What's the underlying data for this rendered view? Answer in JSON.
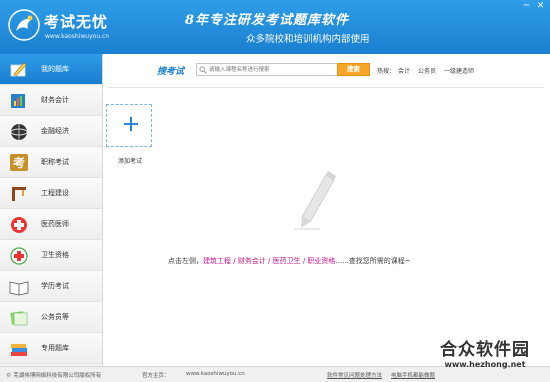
{
  "header": {
    "logo_title": "考试无忧",
    "logo_url": "www.kaoshiwuyou.cn",
    "slogan_main": "8年专注研发考试题库软件",
    "slogan_sub": "众多院校和培训机构内部使用",
    "minimize_glyph": "─",
    "close_glyph": "✕"
  },
  "sidebar": {
    "items": [
      {
        "label": "我的题库",
        "icon": "pen-paper-icon",
        "active": true
      },
      {
        "label": "财务会计",
        "icon": "chart-book-icon",
        "active": false
      },
      {
        "label": "金融经济",
        "icon": "globe-icon",
        "active": false
      },
      {
        "label": "职称考试",
        "icon": "kao-character-icon",
        "active": false
      },
      {
        "label": "工程建设",
        "icon": "construction-icon",
        "active": false
      },
      {
        "label": "医药医师",
        "icon": "medical-cross-icon",
        "active": false
      },
      {
        "label": "卫生资格",
        "icon": "health-cross-icon",
        "active": false
      },
      {
        "label": "学历考试",
        "icon": "open-book-icon",
        "active": false
      },
      {
        "label": "公务员等",
        "icon": "papers-icon",
        "active": false
      },
      {
        "label": "专用题库",
        "icon": "book-stack-icon",
        "active": false
      }
    ]
  },
  "search": {
    "brand": "搜考试",
    "placeholder": "请输入课程名称进行搜索",
    "button_label": "搜索",
    "hot_label": "热搜：",
    "hot_links": [
      "会计",
      "公务员",
      "一级建造师"
    ]
  },
  "main": {
    "add_exam_label": "添加考试",
    "hint_prefix": "点击左侧，",
    "hint_highlight": "建筑工程 / 财务会计 / 医药卫生 / 职业资格",
    "hint_suffix": "......查找您所需的课程~"
  },
  "footer": {
    "copyright": "© 芜湖伟博网络科技有限公司版权所有",
    "site_label": "官方主页：",
    "site_url": "www.kaoshiwuyou.cn",
    "faq_link": "软件常见问题处理方法",
    "mobile_link": "电脑手机都能做题"
  },
  "watermark": {
    "text": "合众软件园",
    "url": "www.hezhong.net"
  },
  "colors": {
    "header_blue": "#1f8ad8",
    "active_blue": "#1a7ecf",
    "search_button": "#f6a526",
    "hint_highlight": "#c8168c"
  }
}
